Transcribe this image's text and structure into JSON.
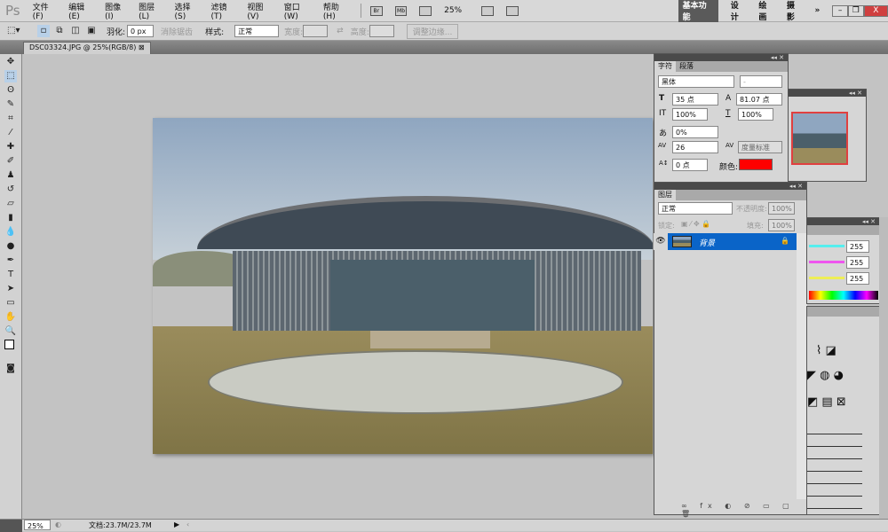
{
  "app": {
    "logo": "Ps"
  },
  "menu": [
    "文件(F)",
    "编辑(E)",
    "图像(I)",
    "图层(L)",
    "选择(S)",
    "滤镜(T)",
    "视图(V)",
    "窗口(W)",
    "帮助(H)"
  ],
  "appbar": {
    "bridge": "Br",
    "minibridge": "Mb",
    "zoom": "25%"
  },
  "workspaces": {
    "active": "基本功能",
    "items": [
      "设计",
      "绘画",
      "摄影"
    ],
    "more": "»"
  },
  "window_buttons": {
    "min": "–",
    "restore": "❐",
    "close": "X"
  },
  "options": {
    "feather_label": "羽化:",
    "feather_value": "0 px",
    "antialias": "消除锯齿",
    "style_label": "样式:",
    "style_value": "正常",
    "width_label": "宽度:",
    "height_label": "高度:",
    "refine": "调整边缘..."
  },
  "document": {
    "tab": "DSC03324.JPG @ 25%(RGB/8)",
    "close": "⊠"
  },
  "character": {
    "tabs": [
      "字符",
      "段落"
    ],
    "font": "黑体",
    "style": "-",
    "size": "35 点",
    "leading": "81.07 点",
    "vscale": "100%",
    "hscale": "100%",
    "tsume": "0%",
    "tracking": "26",
    "kerning": "度量标准",
    "baseline": "0 点",
    "color_label": "颜色:",
    "color": "#ff0000"
  },
  "layers": {
    "tab": "图层",
    "blend": "正常",
    "opacity_label": "不透明度:",
    "opacity": "100%",
    "lock_label": "锁定:",
    "fill_label": "填充:",
    "fill": "100%",
    "items": [
      {
        "name": "背景",
        "locked": true,
        "visible": true
      }
    ]
  },
  "color_panel": {
    "values": [
      "255",
      "255",
      "255"
    ]
  },
  "status": {
    "zoom": "25%",
    "doc": "文档:23.7M/23.7M"
  },
  "colors": {
    "selection": "#0a64c8",
    "text_color_swatch": "#ff0000"
  }
}
